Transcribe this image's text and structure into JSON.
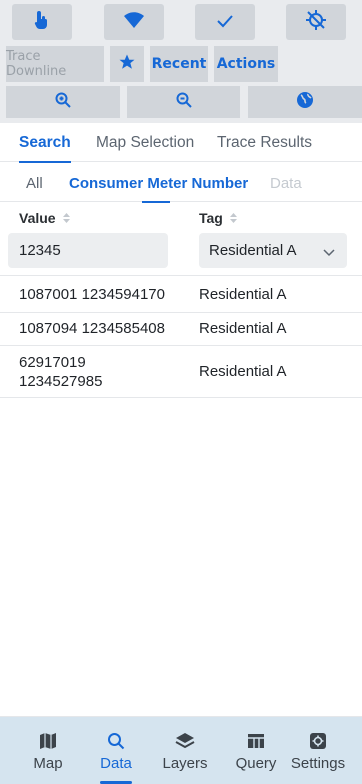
{
  "colors": {
    "accent": "#1668d6",
    "toolbar_bg": "#e9ebee",
    "nav_bg": "#d5e4ef"
  },
  "toolbar": {
    "row1": [
      {
        "icon": "tap-hand-icon"
      },
      {
        "icon": "wifi-icon"
      },
      {
        "icon": "checkmark-icon"
      },
      {
        "icon": "location-off-icon"
      }
    ],
    "row2": {
      "trace_downline": "Trace Downline",
      "recent": "Recent",
      "actions": "Actions"
    },
    "row3": [
      {
        "icon": "zoom-in-icon"
      },
      {
        "icon": "zoom-out-icon"
      },
      {
        "icon": "globe-icon"
      }
    ]
  },
  "primary_tabs": [
    "Search",
    "Map Selection",
    "Trace Results"
  ],
  "secondary_tabs": [
    "All",
    "Consumer Meter Number",
    "Data"
  ],
  "table": {
    "columns": [
      "Value",
      "Tag"
    ],
    "filter_value": "12345",
    "filter_tag": "Residential A",
    "rows": [
      {
        "value": "1087001 1234594170",
        "tag": "Residential A"
      },
      {
        "value": "1087094 1234585408",
        "tag": "Residential A"
      },
      {
        "value": "62917019\n1234527985",
        "value_line1": "62917019",
        "value_line2": "1234527985",
        "tag": "Residential A"
      }
    ]
  },
  "bottom_nav": [
    {
      "label": "Map",
      "icon": "map-icon"
    },
    {
      "label": "Data",
      "icon": "search-icon"
    },
    {
      "label": "Layers",
      "icon": "layers-icon"
    },
    {
      "label": "Query",
      "icon": "table-icon"
    },
    {
      "label": "Settings",
      "icon": "settings-icon"
    }
  ]
}
